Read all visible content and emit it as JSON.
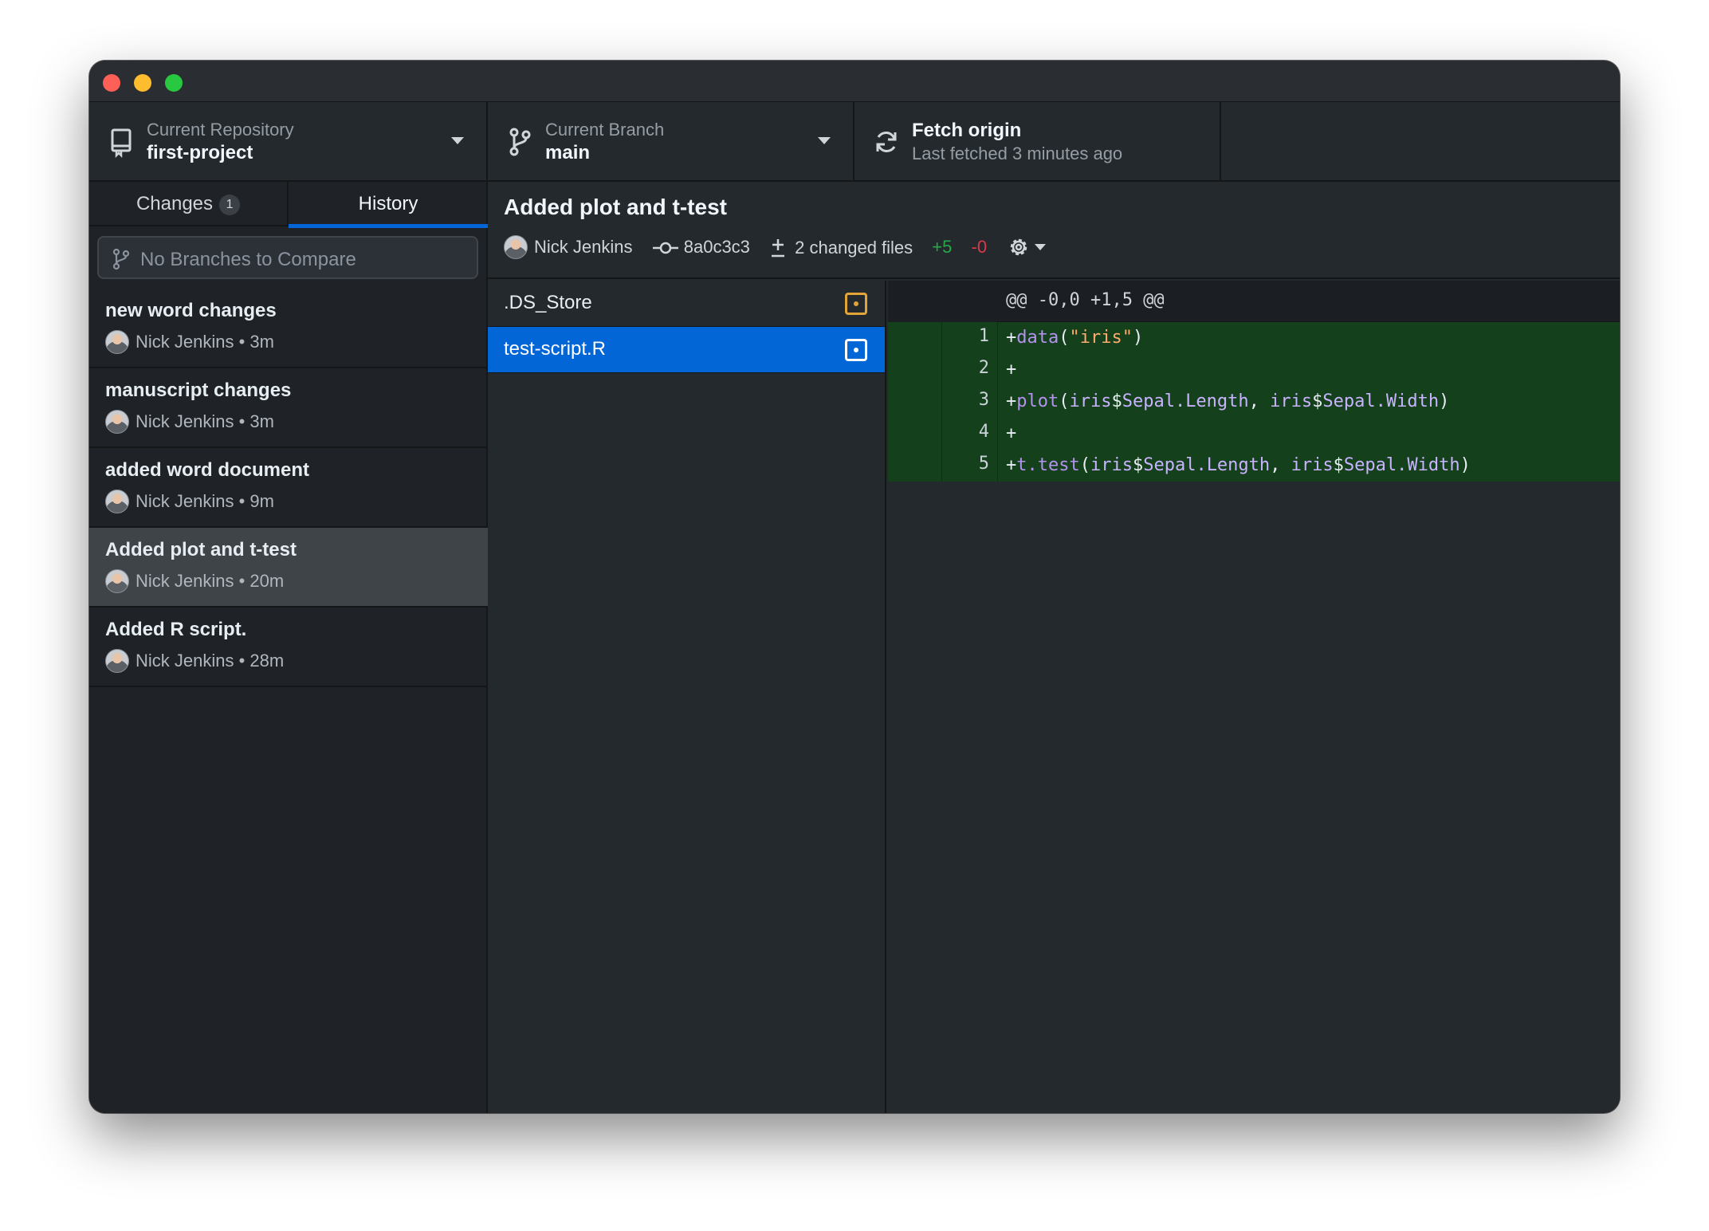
{
  "toolbar": {
    "repo": {
      "label": "Current Repository",
      "value": "first-project"
    },
    "branch": {
      "label": "Current Branch",
      "value": "main"
    },
    "fetch": {
      "label": "Fetch origin",
      "value": "Last fetched 3 minutes ago"
    }
  },
  "sidebar": {
    "tabs": [
      {
        "label": "Changes",
        "badge": "1"
      },
      {
        "label": "History"
      }
    ],
    "compare_placeholder": "No Branches to Compare",
    "commits": [
      {
        "title": "new word changes",
        "meta": "Nick Jenkins • 3m"
      },
      {
        "title": "manuscript changes",
        "meta": "Nick Jenkins • 3m"
      },
      {
        "title": "added word document",
        "meta": "Nick Jenkins • 9m"
      },
      {
        "title": "Added plot and t-test",
        "meta": "Nick Jenkins • 20m"
      },
      {
        "title": "Added R script.",
        "meta": "Nick Jenkins • 28m"
      }
    ]
  },
  "commit": {
    "summary": "Added plot and t-test",
    "author": "Nick Jenkins",
    "sha": "8a0c3c3",
    "changed_files": "2 changed files",
    "additions": "+5",
    "deletions": "-0"
  },
  "files": [
    {
      "name": ".DS_Store"
    },
    {
      "name": "test-script.R"
    }
  ],
  "diff": {
    "hunk_header": "@@ -0,0 +1,5 @@",
    "lines": [
      {
        "num": "1",
        "prefix": "+",
        "fn": "data",
        "open": "(",
        "str": "\"iris\"",
        "close": ")"
      },
      {
        "num": "2",
        "prefix": "+"
      },
      {
        "num": "3",
        "prefix": "+",
        "fn": "plot",
        "open": "(",
        "a1": "iris",
        "d1": "$",
        "b1": "Sepal.Length",
        "sep": ", ",
        "a2": "iris",
        "d2": "$",
        "b2": "Sepal.Width",
        "close": ")"
      },
      {
        "num": "4",
        "prefix": "+"
      },
      {
        "num": "5",
        "prefix": "+",
        "fn": "t.test",
        "open": "(",
        "a1": "iris",
        "d1": "$",
        "b1": "Sepal.Length",
        "sep": ", ",
        "a2": "iris",
        "d2": "$",
        "b2": "Sepal.Width",
        "close": ")"
      }
    ]
  },
  "colors": {
    "accent": "#0366d6",
    "added_bg": "#15401c",
    "modified": "#e2a437",
    "additions": "#28a745",
    "deletions": "#d73a49"
  }
}
